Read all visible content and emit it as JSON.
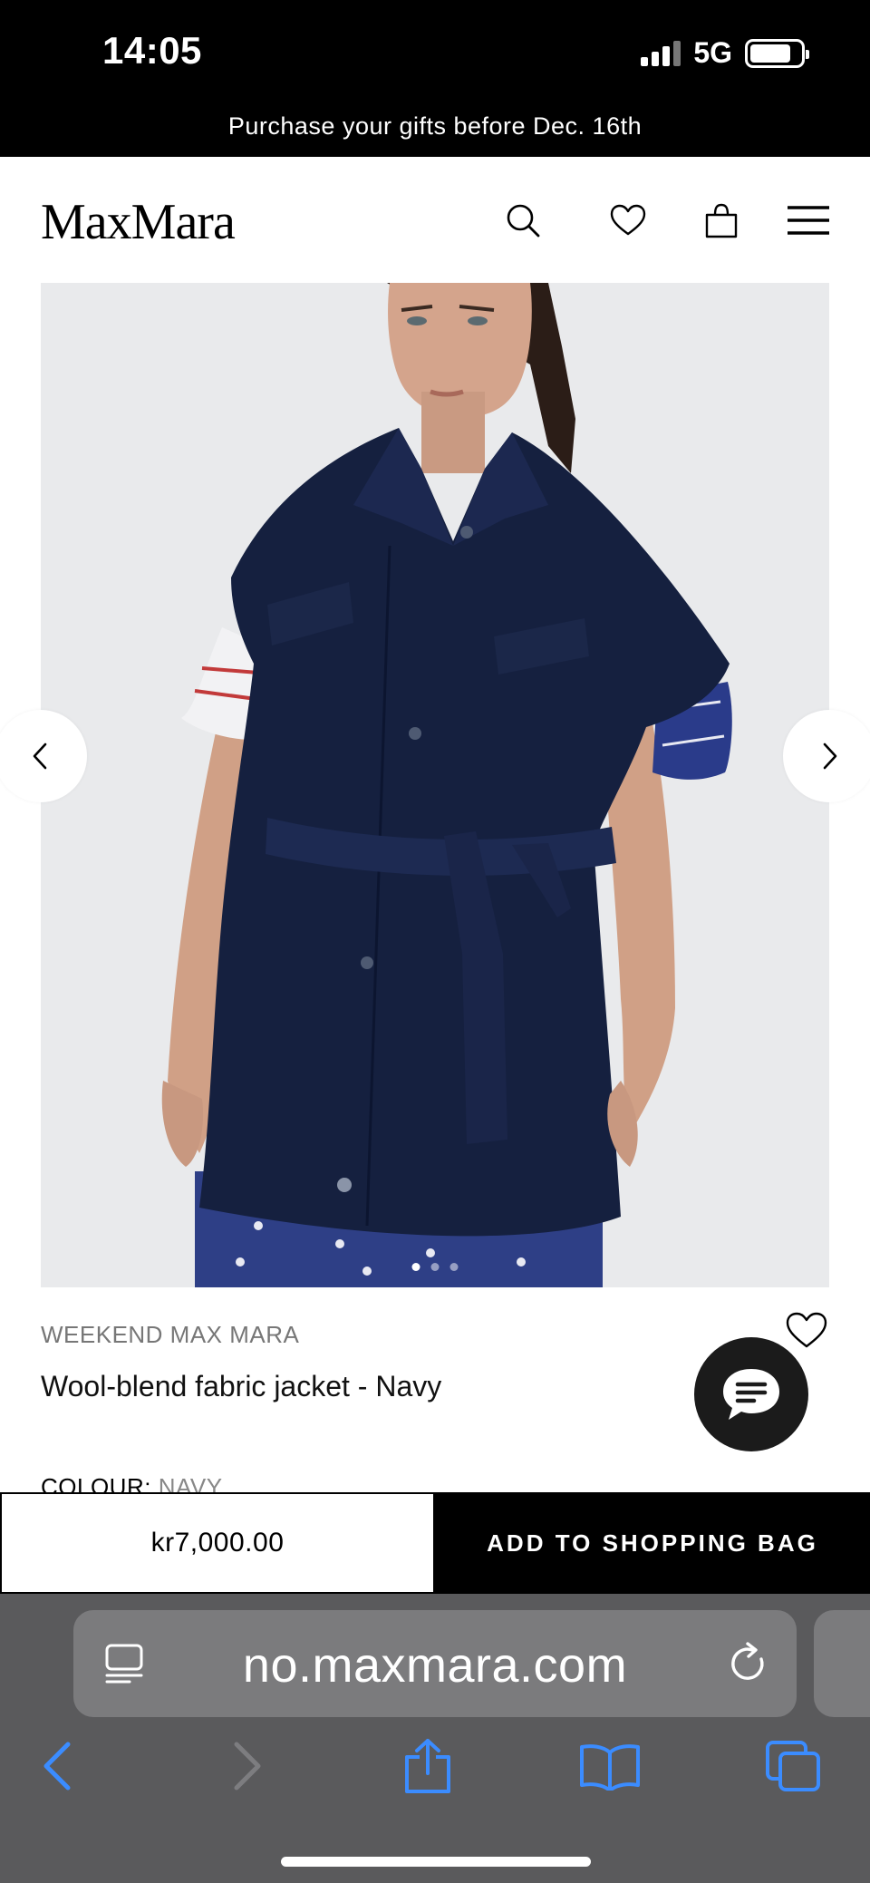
{
  "status_bar": {
    "time": "14:05",
    "network": "5G",
    "battery_level": 0.82
  },
  "promo": {
    "text": "Purchase your gifts before Dec. 16th"
  },
  "header": {
    "logo": "MaxMara",
    "icons": [
      "search-icon",
      "heart-icon",
      "shopping-bag-icon",
      "menu-icon"
    ]
  },
  "gallery": {
    "image_description": "Model wearing navy wool-blend sleeveless belted jacket over printed blouse",
    "slides": 3,
    "active_slide": 1
  },
  "product": {
    "brand": "WEEKEND MAX MARA",
    "title": "Wool-blend fabric jacket - Navy",
    "colour_label": "COLOUR:",
    "colour_value": "NAVY"
  },
  "buy": {
    "price": "kr7,000.00",
    "add_label": "ADD TO SHOPPING BAG"
  },
  "browser": {
    "url": "no.maxmara.com"
  },
  "colors": {
    "jacket": "#15203f",
    "background": "#e9eaec",
    "black": "#000000",
    "safari_bar": "#5a5a5c",
    "link_blue": "#3b8cff"
  }
}
